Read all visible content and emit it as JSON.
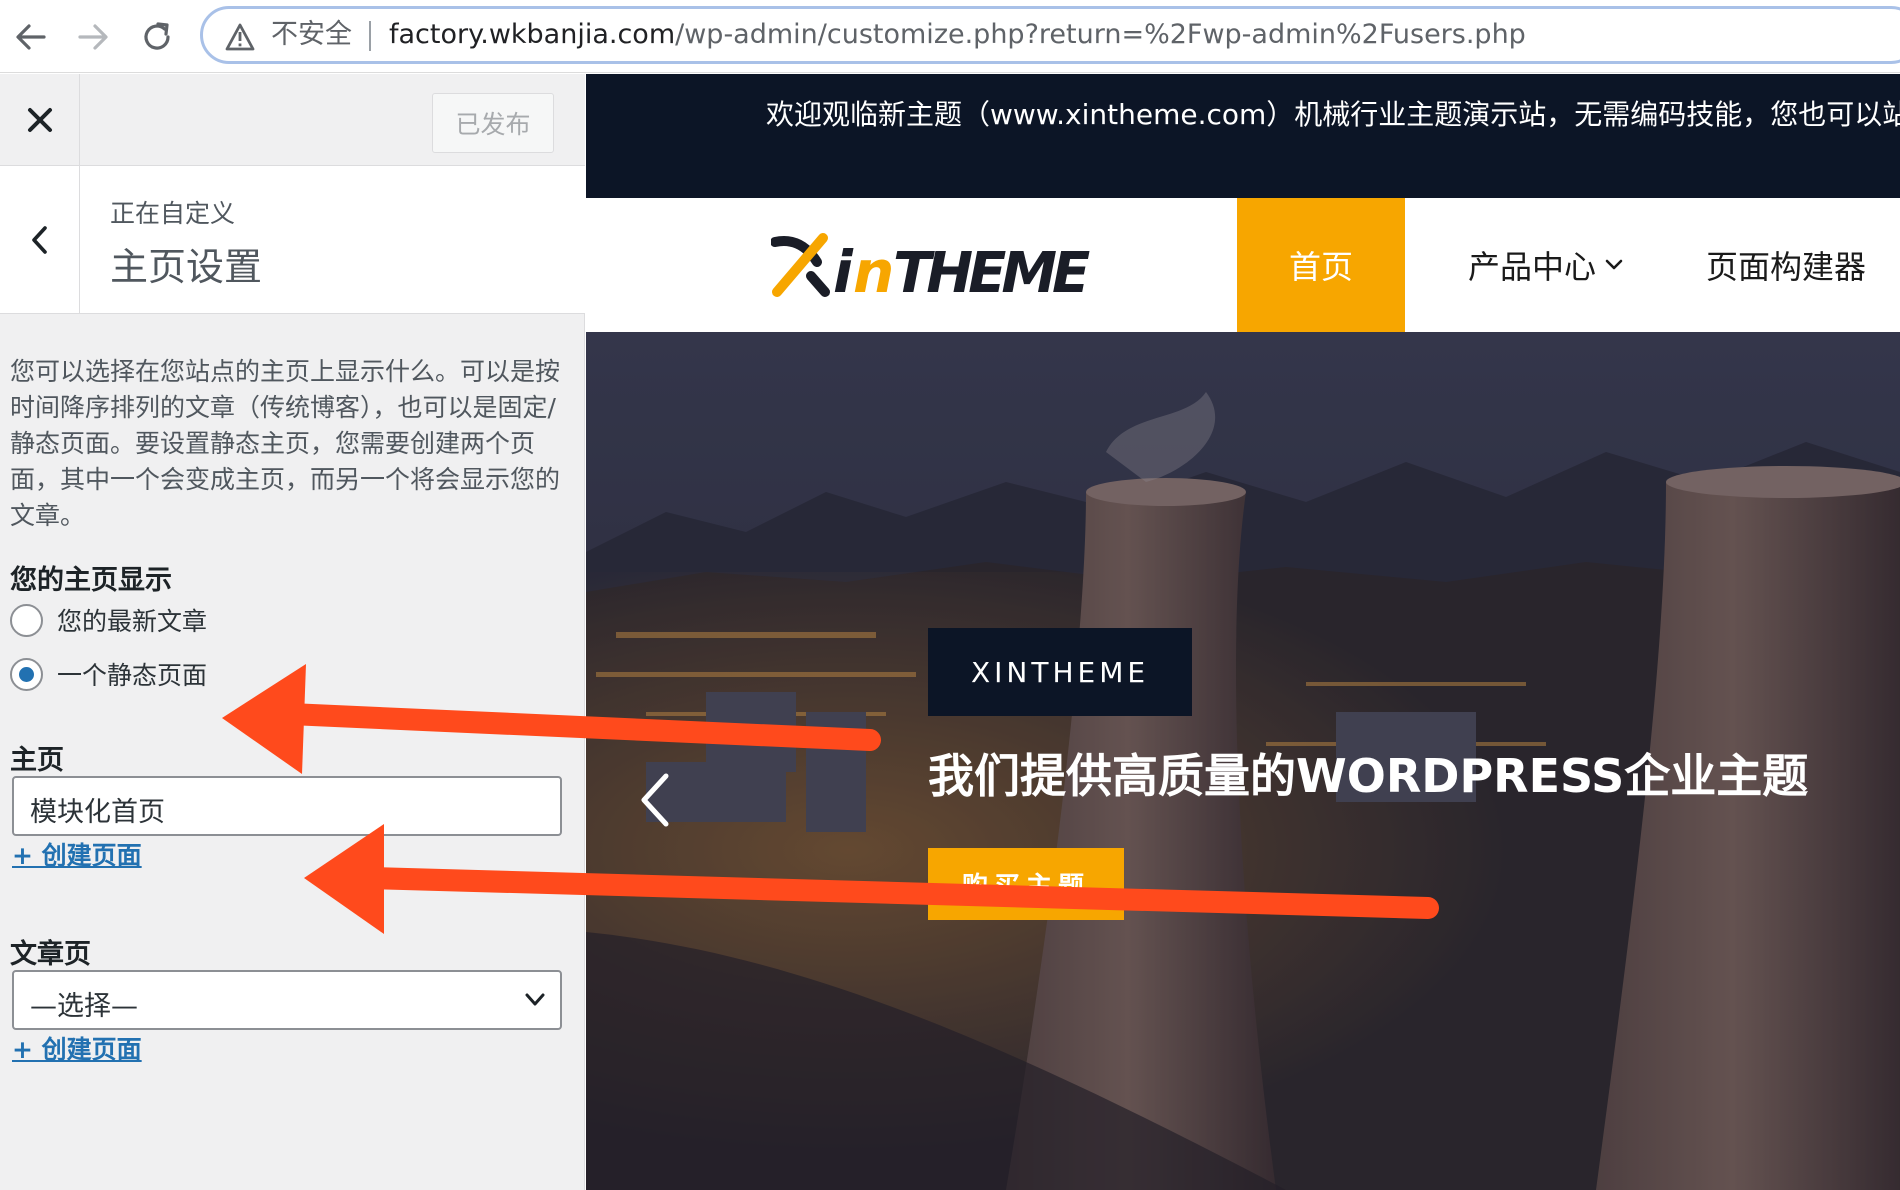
{
  "browser": {
    "security_label": "不安全",
    "url_host": "factory.wkbanjia.com",
    "url_path": "/wp-admin/customize.php?return=%2Fwp-admin%2Fusers.php",
    "icons": [
      "back-arrow-icon",
      "forward-arrow-icon",
      "reload-icon",
      "warning-icon"
    ]
  },
  "customizer": {
    "publish_label": "已发布",
    "customizing_label": "正在自定义",
    "section_title": "主页设置",
    "description": "您可以选择在您站点的主页上显示什么。可以是按时间降序排列的文章（传统博客），也可以是固定/静态页面。要设置静态主页，您需要创建两个页面，其中一个会变成主页，而另一个将会显示您的文章。",
    "homepage_display": {
      "heading": "您的主页显示",
      "options": [
        {
          "label": "您的最新文章",
          "checked": false
        },
        {
          "label": "一个静态页面",
          "checked": true
        }
      ]
    },
    "homepage": {
      "heading": "主页",
      "selected": "模块化首页",
      "add_link": "+ 创建页面"
    },
    "posts_page": {
      "heading": "文章页",
      "selected": "—选择—",
      "add_link": "+ 创建页面"
    },
    "accent_color": "#2271b1"
  },
  "preview": {
    "announcement": "欢迎观临新主题（www.xintheme.com）机械行业主题演示站，无需编码技能，您也可以站。",
    "logo_text": "XINTHEME",
    "menu": [
      {
        "label": "首页",
        "active": true
      },
      {
        "label": "产品中心",
        "has_dropdown": true
      },
      {
        "label": "页面构建器"
      }
    ],
    "hero": {
      "tag": "XINTHEME",
      "title": "我们提供高质量的WORDPRESS企业主题",
      "button": "购买主题"
    },
    "brand_color": "#f7a600",
    "dark_color": "#0c1526"
  },
  "annotation_arrow_color": "#ff4a1c"
}
